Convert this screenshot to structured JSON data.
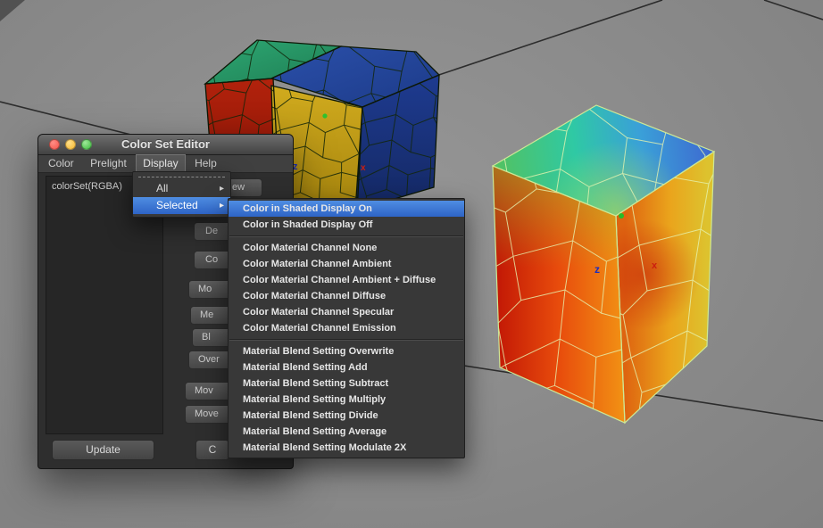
{
  "viewport": {
    "markers": {
      "axis_z": "z",
      "axis_x": "x"
    }
  },
  "window": {
    "title": "Color Set Editor",
    "menu_bar": [
      {
        "label": "Color"
      },
      {
        "label": "Prelight"
      },
      {
        "label": "Display"
      },
      {
        "label": "Help"
      }
    ],
    "list": {
      "items": [
        "colorSet(RGBA)"
      ]
    },
    "side_buttons": [
      {
        "label": "ew"
      },
      {
        "label": "De"
      },
      {
        "label": "Co"
      },
      {
        "label": "Mo"
      },
      {
        "label": "Me"
      },
      {
        "label": "Bl"
      },
      {
        "label": "Over"
      },
      {
        "label": "Mov"
      },
      {
        "label": "Move"
      }
    ],
    "footer": {
      "update_label": "Update",
      "partial_label": "C"
    }
  },
  "display_menu": {
    "arrow": "▸",
    "items": [
      {
        "label": "All"
      },
      {
        "label": "Selected"
      }
    ]
  },
  "submenu": {
    "items": [
      {
        "label": "Color in Shaded Display On"
      },
      {
        "label": "Color in Shaded Display Off"
      },
      {
        "label": "Color Material Channel None"
      },
      {
        "label": "Color Material Channel Ambient"
      },
      {
        "label": "Color Material Channel Ambient + Diffuse"
      },
      {
        "label": "Color Material Channel Diffuse"
      },
      {
        "label": "Color Material Channel Specular"
      },
      {
        "label": "Color Material Channel Emission"
      },
      {
        "label": "Material Blend Setting Overwrite"
      },
      {
        "label": "Material Blend Setting Add"
      },
      {
        "label": "Material Blend Setting Subtract"
      },
      {
        "label": "Material Blend Setting Multiply"
      },
      {
        "label": "Material Blend Setting Divide"
      },
      {
        "label": "Material Blend Setting Average"
      },
      {
        "label": "Material Blend Setting Modulate 2X"
      }
    ]
  },
  "colors": {
    "highlight": "#3a74d4",
    "window_bg": "#2e2e2e",
    "viewport_bg": "#8a8a8a"
  }
}
